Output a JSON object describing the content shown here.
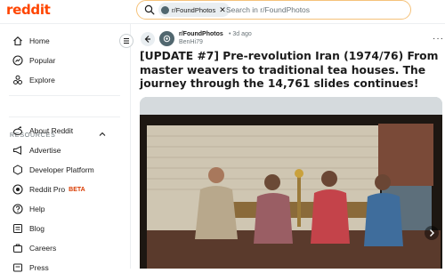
{
  "header": {
    "logo_text": "reddit",
    "search_chip": "r/FoundPhotos",
    "search_chip_remove": "✕",
    "search_placeholder": "Search in r/FoundPhotos"
  },
  "sidebar": {
    "items": [
      {
        "label": "Home",
        "icon": "home-icon"
      },
      {
        "label": "Popular",
        "icon": "popular-icon"
      },
      {
        "label": "Explore",
        "icon": "explore-icon"
      }
    ],
    "resources_heading": "RESOURCES",
    "resources": [
      {
        "label": "About Reddit",
        "icon": "reddit-alien-icon"
      },
      {
        "label": "Advertise",
        "icon": "megaphone-icon"
      },
      {
        "label": "Developer Platform",
        "icon": "developer-icon"
      },
      {
        "label": "Reddit Pro",
        "icon": "reddit-pro-icon",
        "badge": "BETA"
      },
      {
        "label": "Help",
        "icon": "help-icon"
      },
      {
        "label": "Blog",
        "icon": "blog-icon"
      },
      {
        "label": "Careers",
        "icon": "careers-icon"
      },
      {
        "label": "Press",
        "icon": "press-icon"
      }
    ]
  },
  "post": {
    "subreddit": "r/FoundPhotos",
    "separator": "•",
    "age": "3d ago",
    "author": "BenHi79",
    "more_label": "···",
    "title": "[UPDATE #7] Pre-revolution Iran (1974/76) From master weavers to traditional tea houses. The journey through the 14,761 slides continues!"
  },
  "colors": {
    "brand": "#ff4500",
    "search_border": "#f5c27a",
    "muted_text": "#6a7479"
  }
}
